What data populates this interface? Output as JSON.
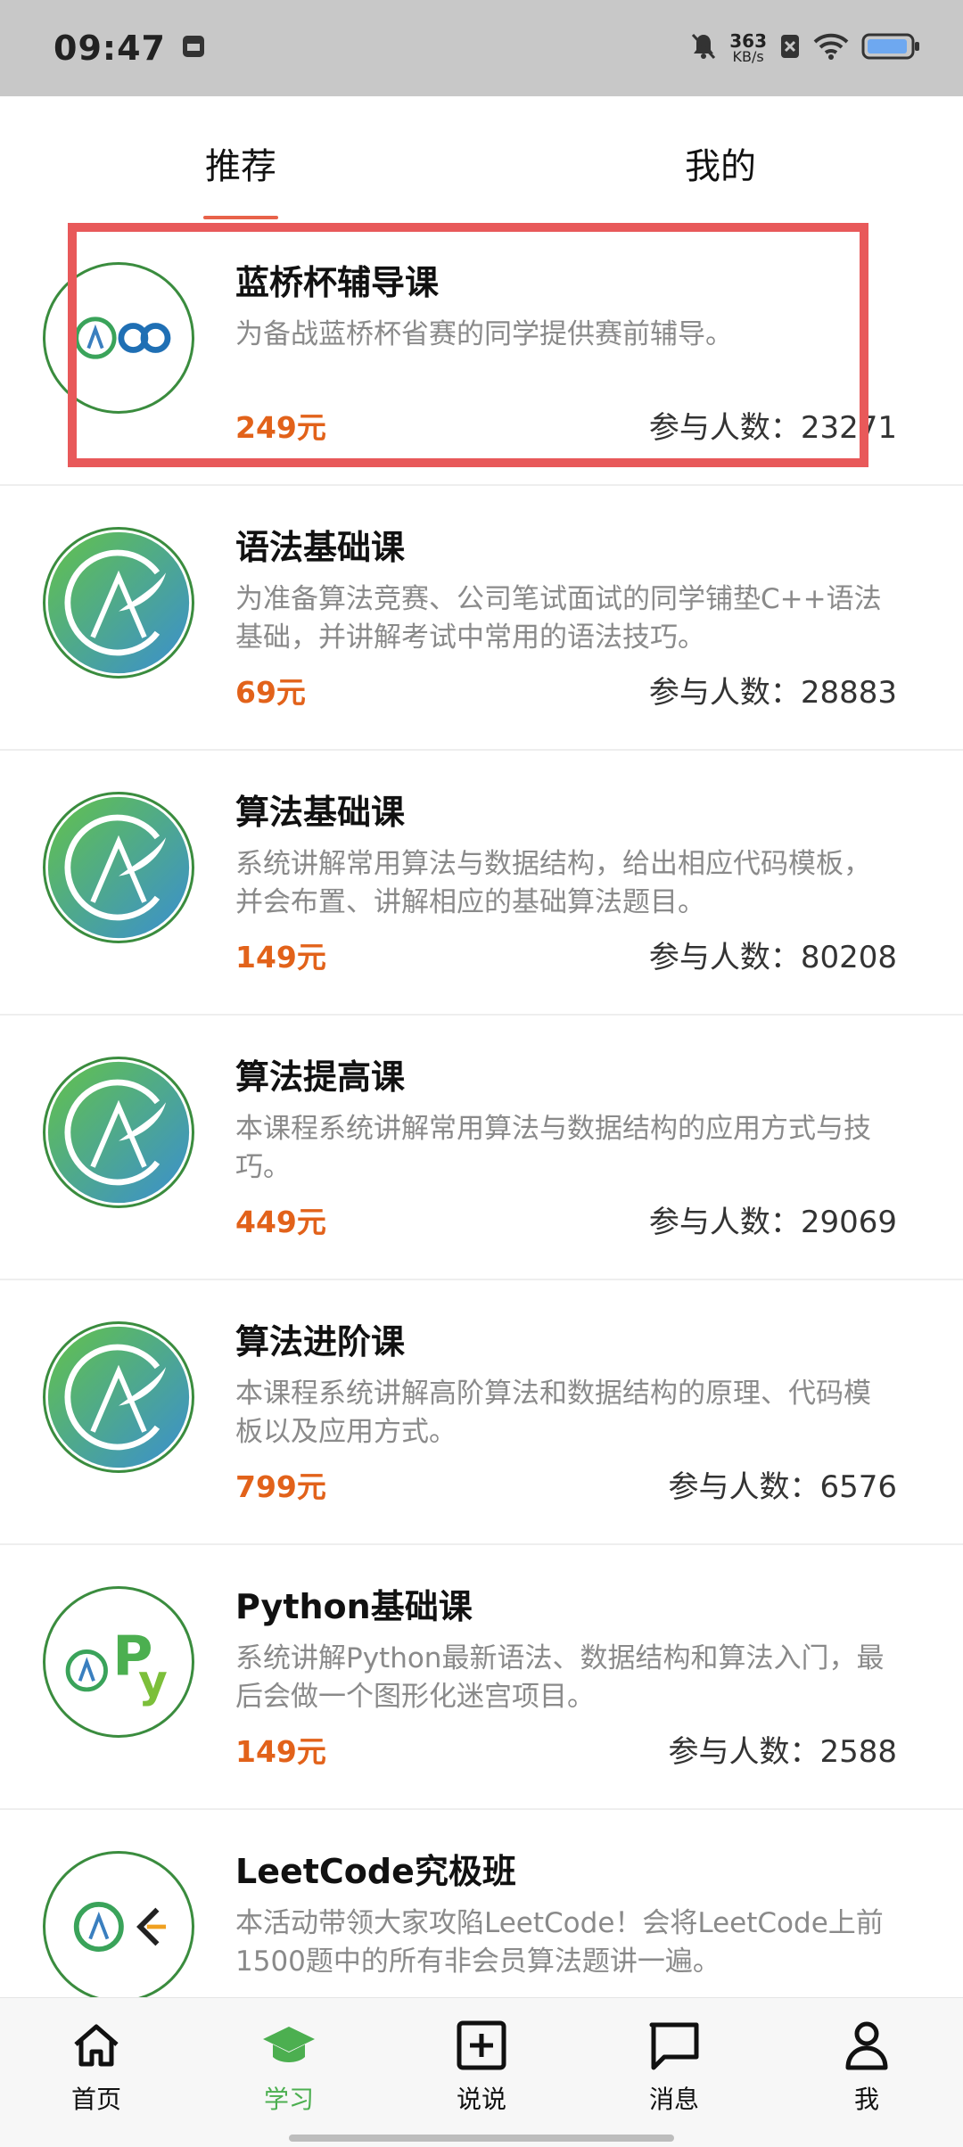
{
  "status_bar": {
    "time": "09:47",
    "net_speed_value": "363",
    "net_speed_unit": "KB/s",
    "icons": [
      "mute-icon",
      "sim-x-icon",
      "wifi-icon",
      "battery-icon"
    ]
  },
  "tabs": [
    {
      "label": "推荐",
      "active": true
    },
    {
      "label": "我的",
      "active": false
    }
  ],
  "courses": [
    {
      "title": "蓝桥杯辅导课",
      "desc": "为备战蓝桥杯省赛的同学提供赛前辅导。",
      "price": "249元",
      "count_label": "参与人数：23271",
      "logo": "acwing-lanqiao-logo"
    },
    {
      "title": "语法基础课",
      "desc": "为准备算法竞赛、公司笔试面试的同学铺垫C++语法基础，并讲解考试中常用的语法技巧。",
      "price": "69元",
      "count_label": "参与人数：28883",
      "logo": "acwing-logo"
    },
    {
      "title": "算法基础课",
      "desc": "系统讲解常用算法与数据结构，给出相应代码模板，并会布置、讲解相应的基础算法题目。",
      "price": "149元",
      "count_label": "参与人数：80208",
      "logo": "acwing-logo"
    },
    {
      "title": "算法提高课",
      "desc": "本课程系统讲解常用算法与数据结构的应用方式与技巧。",
      "price": "449元",
      "count_label": "参与人数：29069",
      "logo": "acwing-logo"
    },
    {
      "title": "算法进阶课",
      "desc": "本课程系统讲解高阶算法和数据结构的原理、代码模板以及应用方式。",
      "price": "799元",
      "count_label": "参与人数：6576",
      "logo": "acwing-logo"
    },
    {
      "title": "Python基础课",
      "desc": "系统讲解Python最新语法、数据结构和算法入门，最后会做一个图形化迷宫项目。",
      "price": "149元",
      "count_label": "参与人数：2588",
      "logo": "acwing-python-logo"
    },
    {
      "title": "LeetCode究极班",
      "desc": "本活动带领大家攻陷LeetCode！会将LeetCode上前1500题中的所有非会员算法题讲一遍。",
      "price": "",
      "count_label": "",
      "logo": "acwing-leetcode-logo"
    }
  ],
  "bottom_nav": [
    {
      "label": "首页",
      "icon": "home-icon",
      "active": false
    },
    {
      "label": "学习",
      "icon": "graduation-cap-icon",
      "active": true
    },
    {
      "label": "说说",
      "icon": "add-square-icon",
      "active": false
    },
    {
      "label": "消息",
      "icon": "message-icon",
      "active": false
    },
    {
      "label": "我",
      "icon": "person-icon",
      "active": false
    }
  ],
  "colors": {
    "price": "#e2621a",
    "active_tab_indicator": "#e8624a",
    "highlight_box": "#e8595a",
    "nav_active": "#4caf50"
  }
}
